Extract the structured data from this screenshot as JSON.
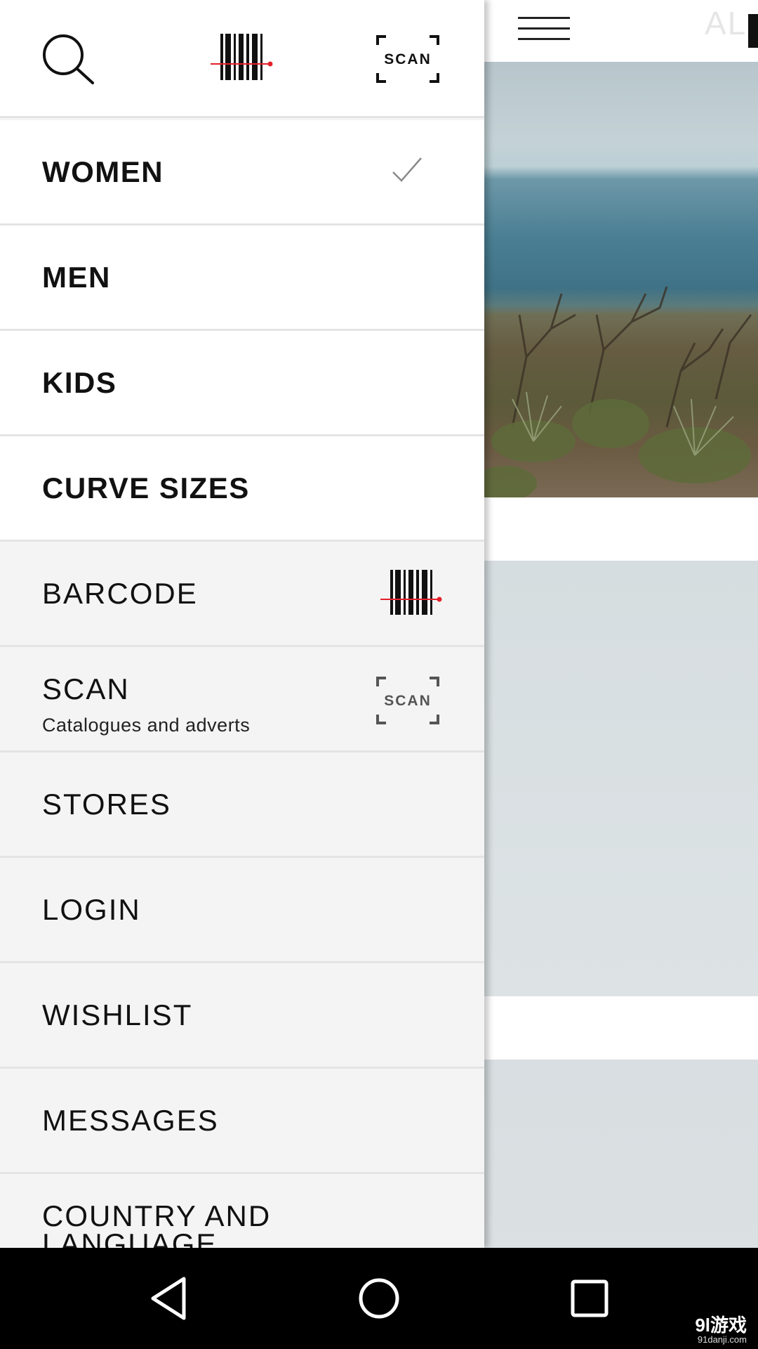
{
  "main": {
    "logo_text": "AL",
    "menu_icon": "hamburger-icon"
  },
  "drawer": {
    "top_icons": [
      "search-icon",
      "barcode-icon",
      "scan-icon"
    ],
    "scan_icon_text": "SCAN",
    "sections": [
      {
        "label": "WOMEN",
        "selected": true,
        "icon": "checkmark-icon"
      },
      {
        "label": "MEN",
        "selected": false
      },
      {
        "label": "KIDS",
        "selected": false
      },
      {
        "label": "CURVE SIZES",
        "selected": false
      }
    ],
    "items": {
      "barcode": {
        "label": "BARCODE",
        "icon": "barcode-icon"
      },
      "scan": {
        "label": "SCAN",
        "sublabel": "Catalogues and adverts",
        "icon": "scan-icon",
        "icon_text": "SCAN"
      },
      "stores": {
        "label": "STORES"
      },
      "login": {
        "label": "LOGIN"
      },
      "wishlist": {
        "label": "WISHLIST"
      },
      "messages": {
        "label": "MESSAGES"
      },
      "country": {
        "label": "COUNTRY AND LANGUAGE"
      }
    }
  },
  "navbar": {
    "buttons": [
      "back-icon",
      "home-icon",
      "recents-icon"
    ],
    "watermark": "9l游戏",
    "watermark_sub": "91danji.com"
  },
  "colors": {
    "accent_red": "#e4202a",
    "primary_row_bg": "#ffffff",
    "secondary_row_bg": "#f4f4f4",
    "divider": "#e4e4e4"
  }
}
